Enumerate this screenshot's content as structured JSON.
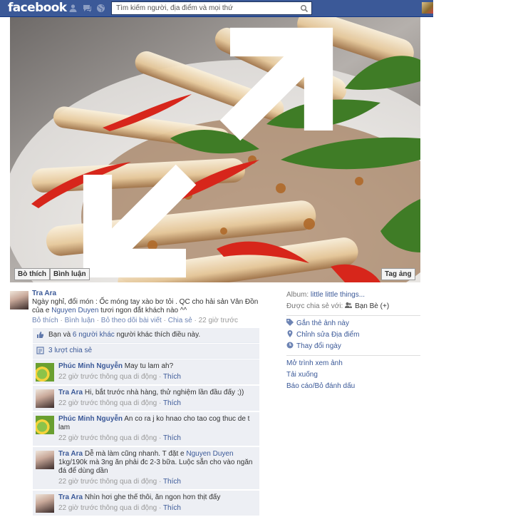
{
  "topbar": {
    "logo": "facebook",
    "search_placeholder": "Tìm kiếm người, địa điểm và mọi thứ"
  },
  "photo": {
    "like_button": "Bò thích",
    "comment_button": "Bình luận",
    "tag_button": "Tag ảng"
  },
  "post": {
    "author": "Tra Ara",
    "text_1": "Ngày nghỉ, đổi món : Ốc móng tay xào bơ tỏi . QC cho hải sản Vân Đồn của e ",
    "mention": "Nguyen Duyen",
    "text_2": " tươi ngon đắt khách nào ^^",
    "actions": {
      "like": "Bỏ thích",
      "comment": "Bình luận",
      "unfollow": "Bỏ theo dõi bài viết",
      "share": "Chia sẻ",
      "time": "22 giờ trước",
      "sep": "·"
    }
  },
  "ufi": {
    "likes_prefix": "Bạn và ",
    "likes_link": "6 người khác",
    "likes_suffix": " người khác thích điều này.",
    "shares": "3 lượt chia sẻ"
  },
  "comments": [
    {
      "name": "Phúc Minh Nguyễn",
      "text": "May tu lam ah?",
      "meta": "22 giờ trước thông qua di động · ",
      "like": "Thích"
    },
    {
      "name": "Tra Ara",
      "text": "Hi, bắt trước nhà hàng, thử nghiệm lần đầu đấy ;))",
      "meta": "22 giờ trước thông qua di động · ",
      "like": "Thích"
    },
    {
      "name": "Phúc Minh Nguyễn",
      "text": "An co ra j ko hnao cho tao cog thuc de t lam",
      "meta": "22 giờ trước thông qua di động · ",
      "like": "Thích"
    },
    {
      "name": "Tra Ara",
      "text_1": "Dễ mà làm cũng nhanh. T đặt e ",
      "mention": "Nguyen Duyen",
      "text_2": " 1kg/190k mà 3ng ăn phải đc 2-3 bữa. Luộc sẵn cho vào ngăn đá để dùng dần",
      "meta": "22 giờ trước thông qua di động · ",
      "like": "Thích"
    },
    {
      "name": "Tra Ara",
      "text": "Nhìn hơi ghe thế thôi, ăn ngon hơn thịt đấy",
      "meta": "22 giờ trước thông qua di động · ",
      "like": "Thích"
    }
  ],
  "sidebar": {
    "album_label": "Album: ",
    "album_link": "little little things...",
    "shared_label": "Được chia sẻ với: ",
    "shared_value": "Bạn Bè (+)",
    "tag_photo": "Gắn thẻ ảnh này",
    "edit_location": "Chỉnh sửa Địa điểm",
    "change_date": "Thay đổi ngày",
    "open_viewer": "Mở trình xem ảnh",
    "download": "Tải xuống",
    "report": "Báo cáo/Bỏ đánh dấu"
  },
  "colors": {
    "brand": "#3b5998",
    "ufi_bg": "#edeff4"
  }
}
